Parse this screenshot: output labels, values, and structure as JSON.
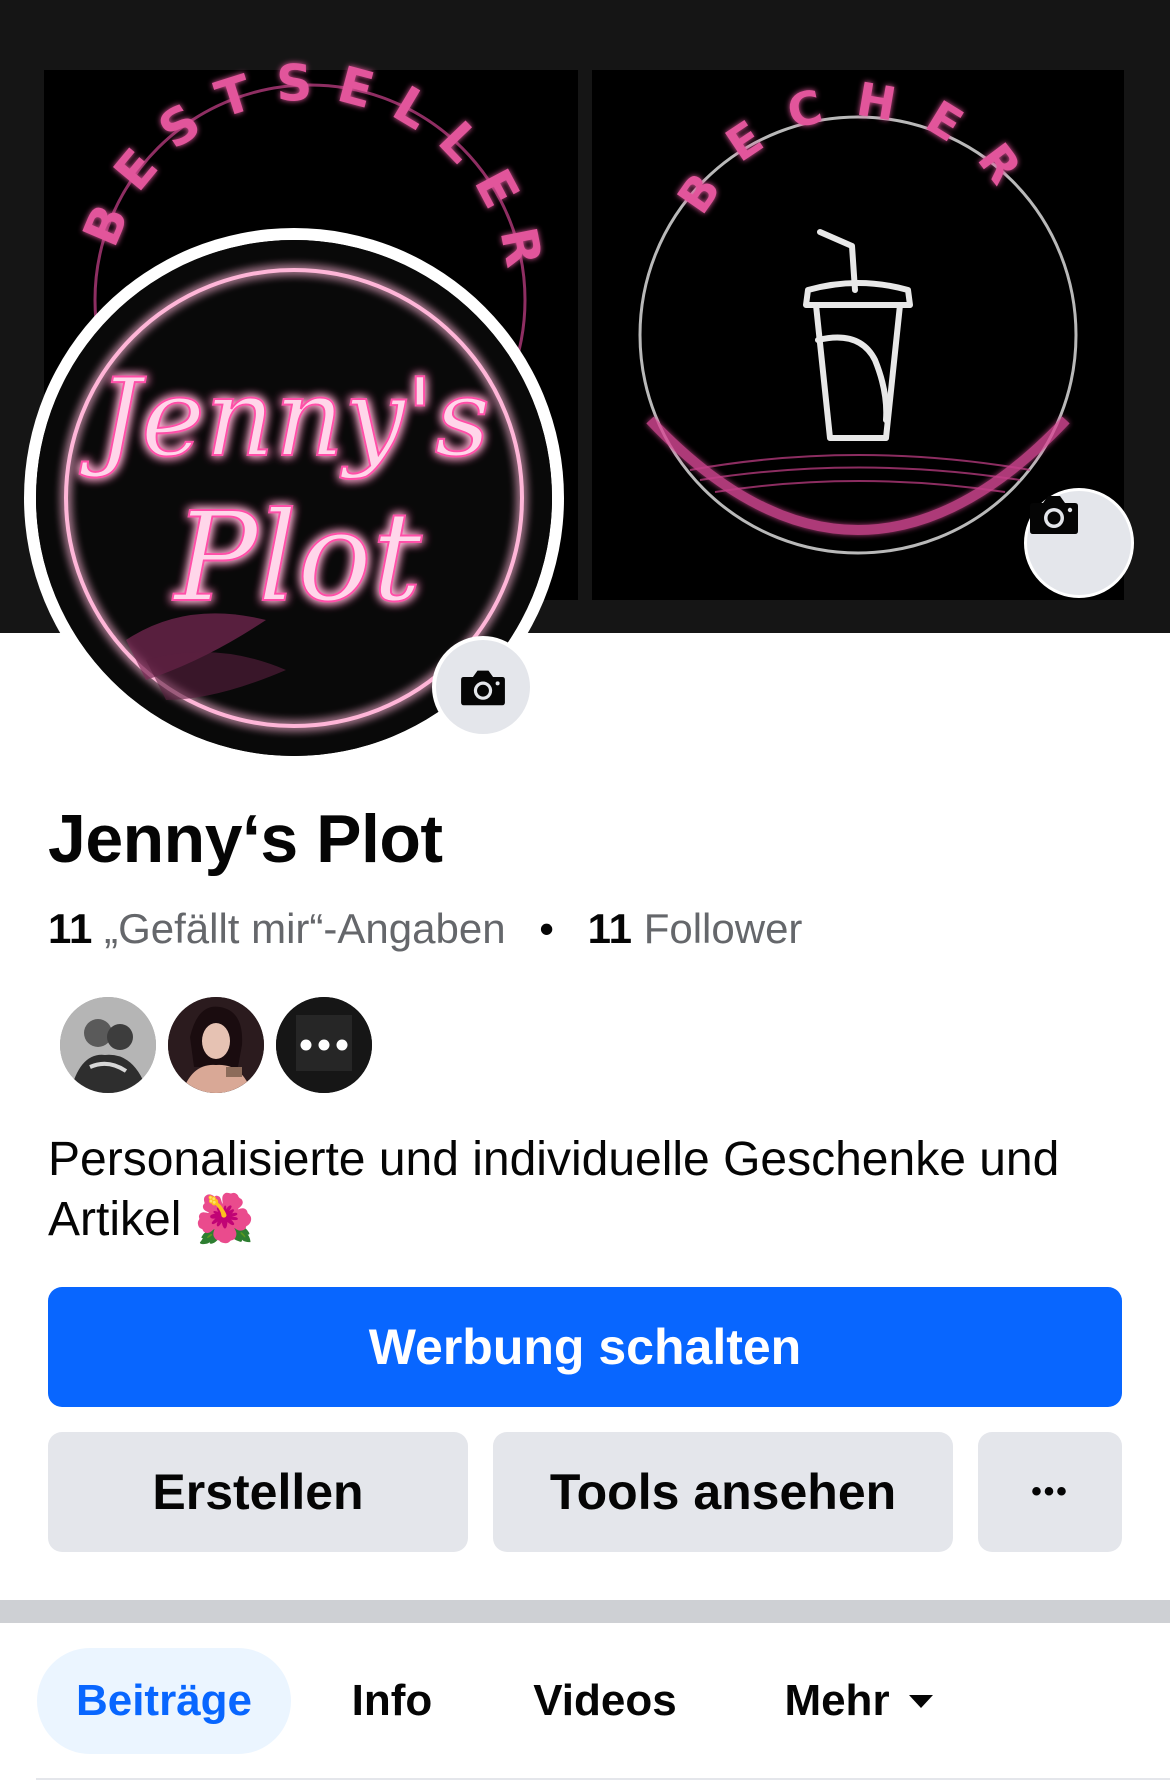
{
  "cover": {
    "left_panel_text": "BESTSELLER",
    "right_panel_text": "BECHER"
  },
  "profile": {
    "logo_line1": "Jenny's",
    "logo_line2": "Plot"
  },
  "page": {
    "title": "Jenny‘s Plot",
    "likes_count": "11",
    "likes_label": "„Gefällt mir“-Angaben",
    "separator": "•",
    "followers_count": "11",
    "followers_label": "Follower",
    "bio_text": "Personalisierte und individuelle Geschenke und Artikel",
    "bio_emoji": "🌺"
  },
  "actions": {
    "primary_label": "Werbung schalten",
    "create_label": "Erstellen",
    "tools_label": "Tools ansehen",
    "more_label": "•••"
  },
  "tabs": [
    {
      "label": "Beiträge",
      "active": true
    },
    {
      "label": "Info",
      "active": false
    },
    {
      "label": "Videos",
      "active": false
    },
    {
      "label": "Mehr",
      "active": false
    }
  ],
  "colors": {
    "accent": "#0866ff",
    "neon_pink": "#ff4fa8",
    "secondary_button": "#e4e6eb"
  },
  "icons": [
    "camera-icon",
    "more-horizontal-icon",
    "caret-down-icon",
    "cup-icon"
  ]
}
